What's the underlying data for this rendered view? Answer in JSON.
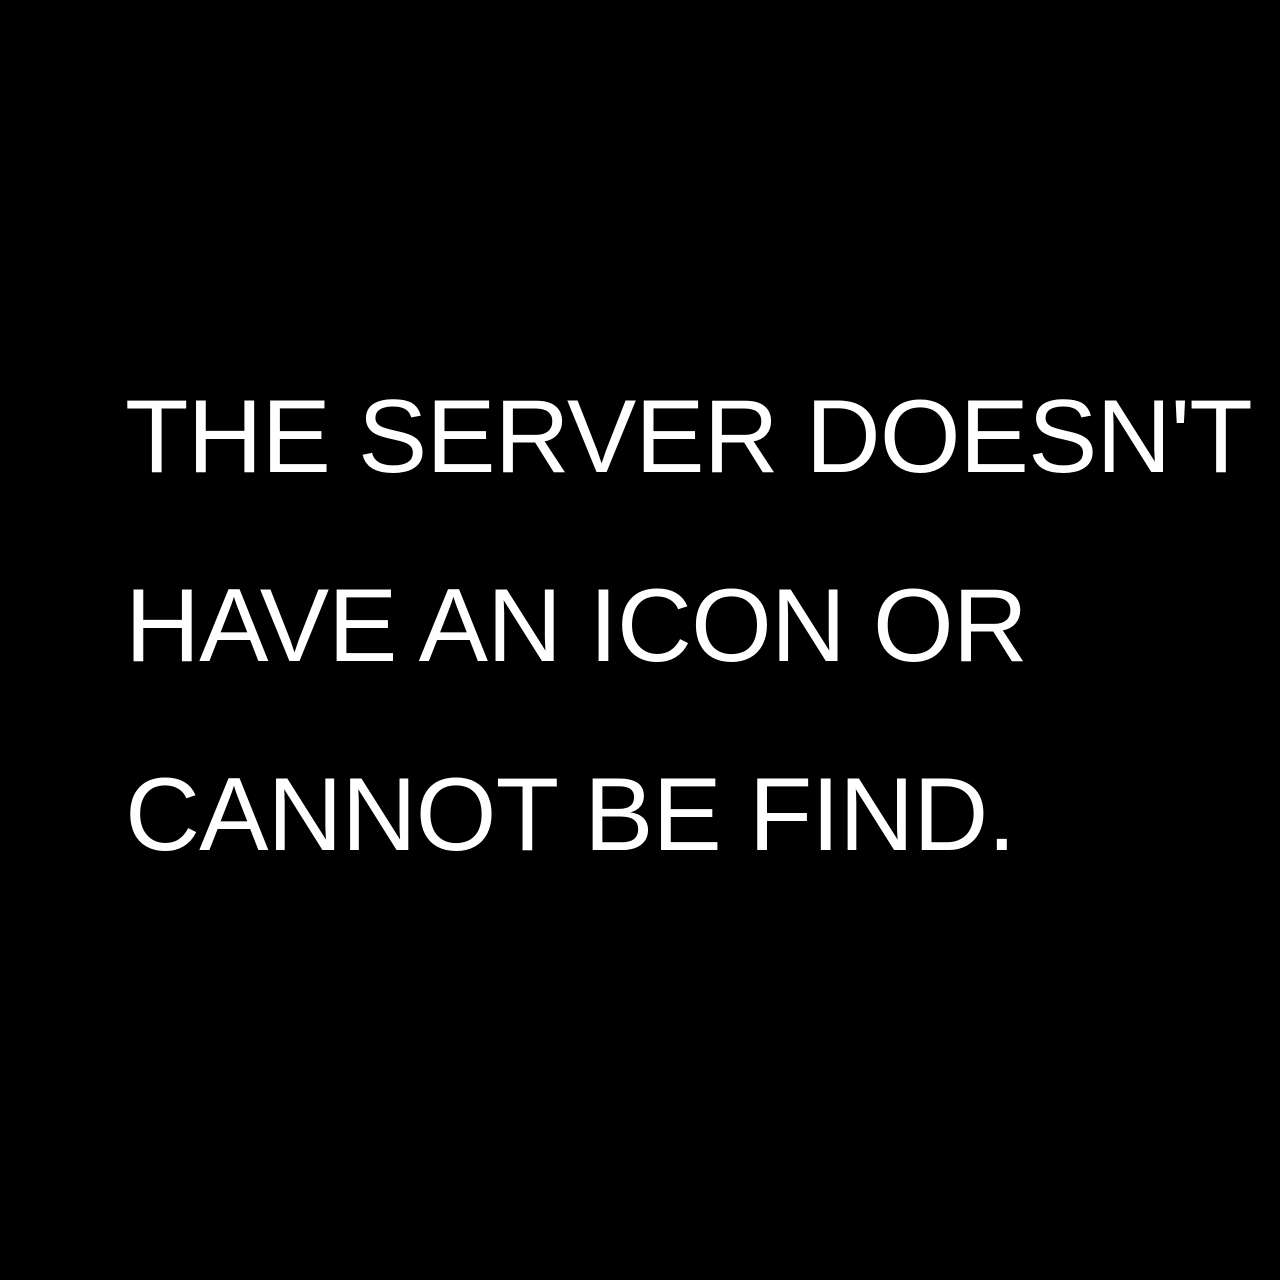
{
  "message": {
    "lines": [
      "THE SERVER DOESN'T",
      "HAVE AN ICON OR",
      "CANNOT BE FIND."
    ]
  },
  "colors": {
    "background": "#000000",
    "text": "#ffffff"
  }
}
